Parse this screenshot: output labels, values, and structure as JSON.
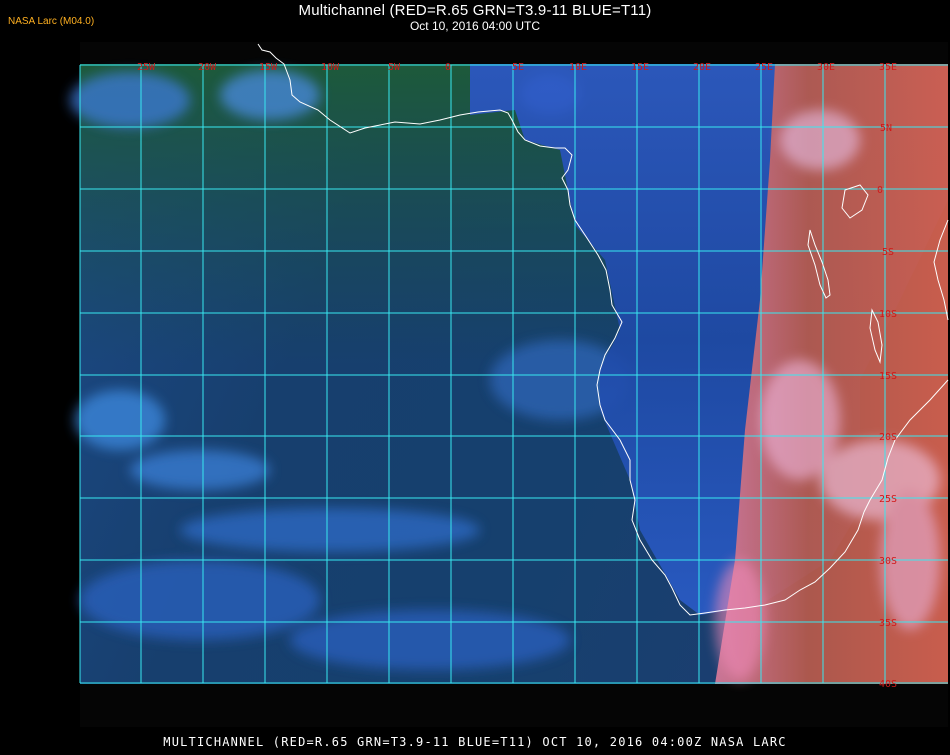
{
  "header": {
    "title": "Multichannel (RED=R.65 GRN=T3.9-11 BLUE=T11)",
    "subtitle": "Oct 10, 2016 04:00 UTC"
  },
  "source_tag": "NASA Larc (M04.0)",
  "footer": {
    "caption": "MULTICHANNEL (RED=R.65 GRN=T3.9-11 BLUE=T11) OCT 10, 2016 04:00Z   NASA LARC"
  },
  "map": {
    "longitude_labels": [
      "25W",
      "20W",
      "15W",
      "10W",
      "5W",
      "0",
      "5E",
      "10E",
      "15E",
      "20E",
      "25E",
      "30E",
      "35E"
    ],
    "latitude_labels": [
      "5N",
      "0",
      "5S",
      "10S",
      "15S",
      "20S",
      "25S",
      "30S",
      "35S",
      "40S"
    ],
    "colors": {
      "grid": "#38e8f0",
      "coastline": "#ffffff",
      "labels": "#d01818",
      "source_tag": "#ffb020"
    }
  }
}
